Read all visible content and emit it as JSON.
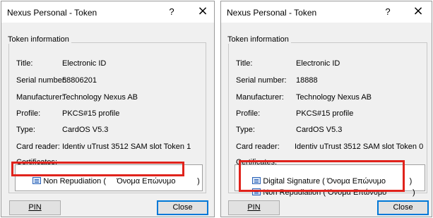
{
  "dialogs": [
    {
      "title": "Nexus Personal - Token",
      "help": "?",
      "close_glyph": "×",
      "group_label": "Token information",
      "labels": {
        "title": "Title:",
        "serial": "Serial number:",
        "manufacturer": "Manufacturer:",
        "profile": "Profile:",
        "type": "Type:",
        "reader": "Card reader:",
        "certificates": "Certificates:"
      },
      "values": {
        "title": "Electronic ID",
        "serial": "58806201",
        "manufacturer": "Technology Nexus AB",
        "profile": "PKCS#15 profile",
        "type": "CardOS V5.3",
        "reader": "Identiv uTrust 3512 SAM slot Token 1"
      },
      "certificates": [
        "Non Repudiation (     Όνομα Επώνυμο          )"
      ],
      "buttons": {
        "pin": "PIN",
        "close": "Close"
      }
    },
    {
      "title": "Nexus Personal - Token",
      "help": "?",
      "close_glyph": "×",
      "group_label": "Token information",
      "labels": {
        "title": "Title:",
        "serial": "Serial number:",
        "manufacturer": "Manufacturer:",
        "profile": "Profile:",
        "type": "Type:",
        "reader": "Card reader:",
        "certificates": "Certificates:"
      },
      "values": {
        "title": "Electronic ID",
        "serial": "18888",
        "manufacturer": "Technology Nexus AB",
        "profile": "PKCS#15 profile",
        "type": "CardOS V5.3",
        "reader": "Identiv uTrust 3512 SAM slot Token 0"
      },
      "certificates": [
        "Digital Signature ( Όνομα Επώνυμο           )",
        "Non Repudiation ( Όνομα Επώνυμο            )"
      ],
      "buttons": {
        "pin": "PIN",
        "close": "Close"
      }
    }
  ],
  "colors": {
    "highlight": "#e0231c",
    "dialog_bg": "#f0f0f0",
    "default_button_border": "#0078d7"
  },
  "icons": {
    "certificate": "certificate-icon"
  }
}
